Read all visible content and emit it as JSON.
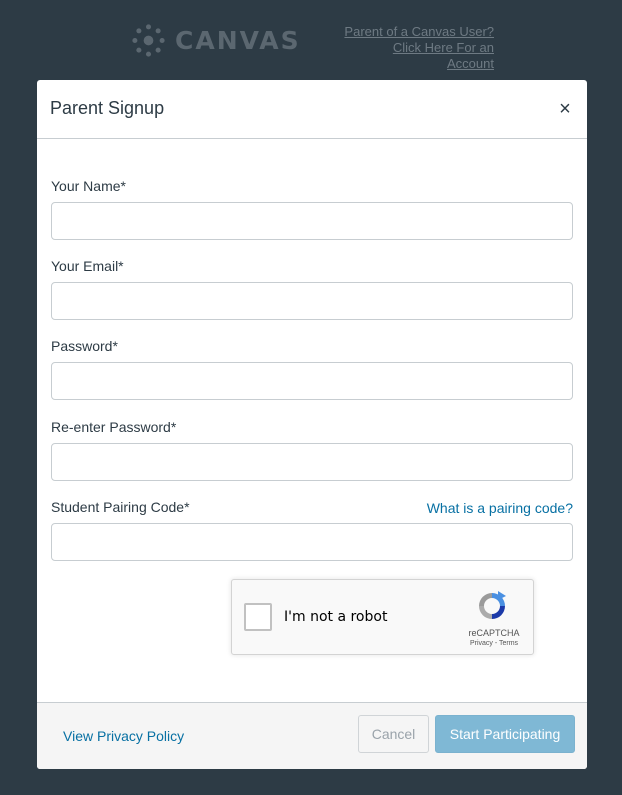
{
  "header": {
    "brand": "CANVAS",
    "parent_link_line1": "Parent of a Canvas User?",
    "parent_link_line2": "Click Here For an Account"
  },
  "modal": {
    "title": "Parent Signup",
    "close_symbol": "×",
    "fields": {
      "name": {
        "label": "Your Name*",
        "value": ""
      },
      "email": {
        "label": "Your Email*",
        "value": ""
      },
      "password": {
        "label": "Password*",
        "value": ""
      },
      "password_confirm": {
        "label": "Re-enter Password*",
        "value": ""
      },
      "pairing_code": {
        "label": "Student Pairing Code*",
        "value": ""
      }
    },
    "pairing_help_link": "What is a pairing code?",
    "captcha": {
      "label": "I'm not a robot",
      "brand": "reCAPTCHA",
      "terms": "Privacy - Terms",
      "checked": false
    },
    "footer": {
      "privacy_link": "View Privacy Policy",
      "cancel_label": "Cancel",
      "submit_label": "Start Participating"
    }
  },
  "colors": {
    "background": "#2d3b45",
    "link": "#0770a3",
    "submit_disabled": "#7fb8d5"
  },
  "icons": {
    "logo": "canvas-logo-icon",
    "close": "close-icon",
    "captcha": "recaptcha-icon"
  }
}
